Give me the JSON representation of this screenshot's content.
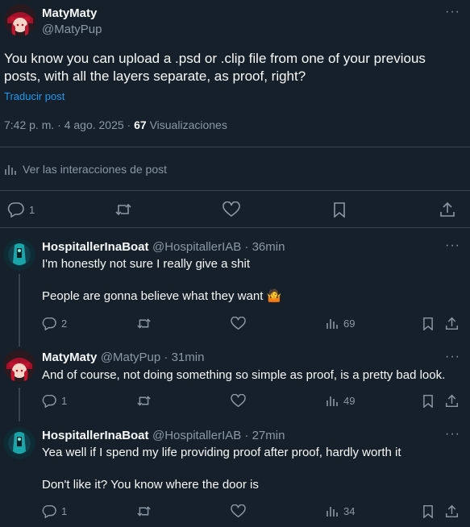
{
  "main_post": {
    "display_name": "MatyMaty",
    "handle": "@MatyPup",
    "text": "You know you can upload a .psd or .clip file from one of your previous posts, with all the layers separate, as proof, right?",
    "translate_label": "Traducir post",
    "time": "7:42 p. m. · 4 ago. 2025 ·",
    "views_count": "67",
    "views_label": "Visualizaciones",
    "interactions_label": "Ver las interacciones de post",
    "reply_count": "1",
    "more_icon": "more-horizontal-icon"
  },
  "replies": [
    {
      "display_name": "HospitallerInaBoat",
      "handle": "@HospitallerIAB · 36min",
      "text1": "I'm honestly not sure I really give a shit",
      "text2": "People are gonna believe what they want 🤷",
      "reply_count": "2",
      "views": "69"
    },
    {
      "display_name": "MatyMaty",
      "handle": "@MatyPup · 31min",
      "text1": "And of course, not doing something so simple as proof, is a pretty bad look.",
      "text2": "",
      "reply_count": "1",
      "views": "49"
    },
    {
      "display_name": "HospitallerInaBoat",
      "handle": "@HospitallerIAB · 27min",
      "text1": "Yea well if I spend my life providing proof after proof, hardly worth it",
      "text2": "Don't like it? You know where the door is",
      "reply_count": "1",
      "views": "34"
    }
  ],
  "colors": {
    "background": "#15202b",
    "text": "#f7f9f9",
    "muted": "#8b98a5",
    "link": "#1d9bf0",
    "divider": "#38444d"
  }
}
